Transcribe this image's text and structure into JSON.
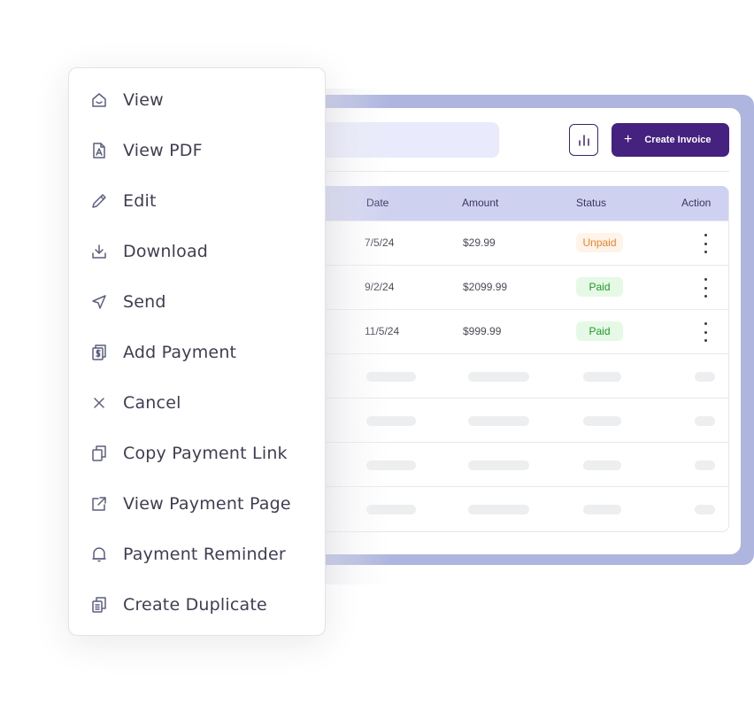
{
  "toolbar": {
    "search_placeholder": "",
    "chart_button_icon": "bar-chart-icon",
    "create_invoice_icon": "plus-icon",
    "create_invoice_label": "Create Invoice"
  },
  "colors": {
    "brand_primary": "#45227f",
    "frame_accent": "#aeb5df",
    "table_header_bg": "#cfd1f0",
    "unpaid_text": "#e9852c",
    "paid_text": "#1f9a2a"
  },
  "table": {
    "columns": [
      "Date",
      "Amount",
      "Status",
      "Action"
    ],
    "rows": [
      {
        "date": "7/5/24",
        "amount": "$29.99",
        "status": "Unpaid"
      },
      {
        "date": "9/2/24",
        "amount": "$2099.99",
        "status": "Paid"
      },
      {
        "date": "11/5/24",
        "amount": "$999.99",
        "status": "Paid"
      }
    ],
    "placeholder_row_count": 4
  },
  "context_menu": {
    "items": [
      {
        "label": "View",
        "icon": "home-icon"
      },
      {
        "label": "View PDF",
        "icon": "pdf-file-icon"
      },
      {
        "label": "Edit",
        "icon": "pencil-icon"
      },
      {
        "label": "Download",
        "icon": "download-icon"
      },
      {
        "label": "Send",
        "icon": "send-icon"
      },
      {
        "label": "Add Payment",
        "icon": "dollar-stack-icon"
      },
      {
        "label": "Cancel",
        "icon": "close-icon"
      },
      {
        "label": "Copy Payment Link",
        "icon": "copy-icon"
      },
      {
        "label": "View Payment Page",
        "icon": "external-link-icon"
      },
      {
        "label": "Payment Reminder",
        "icon": "bell-icon"
      },
      {
        "label": "Create Duplicate",
        "icon": "duplicate-icon"
      }
    ]
  }
}
